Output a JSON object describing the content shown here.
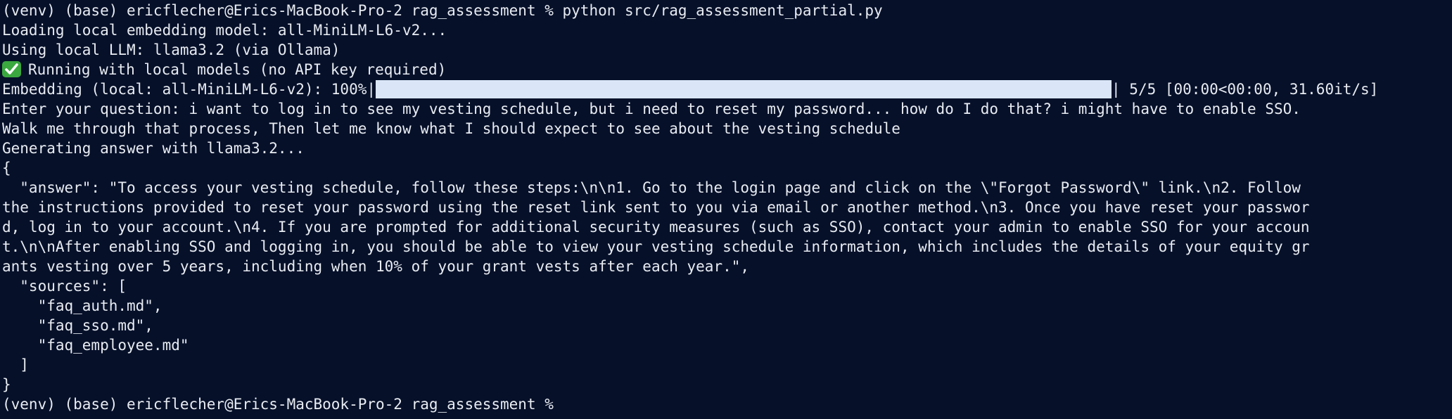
{
  "terminal": {
    "prompt_cmd": "(venv) (base) ericflecher@Erics-MacBook-Pro-2 rag_assessment % python src/rag_assessment_partial.py",
    "loading_line": "Loading local embedding model: all-MiniLM-L6-v2...",
    "llm_line": "Using local LLM: llama3.2 (via Ollama)",
    "running_line": "Running with local models (no API key required)",
    "progress": {
      "prefix": "Embedding (local: all-MiniLM-L6-v2): 100%|",
      "suffix": "| 5/5 [00:00<00:00, 31.60it/s]",
      "percent": 100
    },
    "question_line_1": "Enter your question: i want to log in to see my vesting schedule, but i need to reset my password... how do I do that? i might have to enable SSO.",
    "question_line_2": "Walk me through that process, Then let me know what I should expect to see about the vesting schedule",
    "generating_line": "Generating answer with llama3.2...",
    "json_output": [
      "{",
      "  \"answer\": \"To access your vesting schedule, follow these steps:\\n\\n1. Go to the login page and click on the \\\"Forgot Password\\\" link.\\n2. Follow",
      "the instructions provided to reset your password using the reset link sent to you via email or another method.\\n3. Once you have reset your passwor",
      "d, log in to your account.\\n4. If you are prompted for additional security measures (such as SSO), contact your admin to enable SSO for your accoun",
      "t.\\n\\nAfter enabling SSO and logging in, you should be able to view your vesting schedule information, which includes the details of your equity gr",
      "ants vesting over 5 years, including when 10% of your grant vests after each year.\",",
      "  \"sources\": [",
      "    \"faq_auth.md\",",
      "    \"faq_sso.md\",",
      "    \"faq_employee.md\"",
      "  ]",
      "}"
    ],
    "final_prompt": "(venv) (base) ericflecher@Erics-MacBook-Pro-2 rag_assessment % ",
    "check_icon": "check-mark-button-icon",
    "background_color": "#061029",
    "text_color": "#e8ecf2",
    "progress_fill_color": "#dae6f8"
  }
}
